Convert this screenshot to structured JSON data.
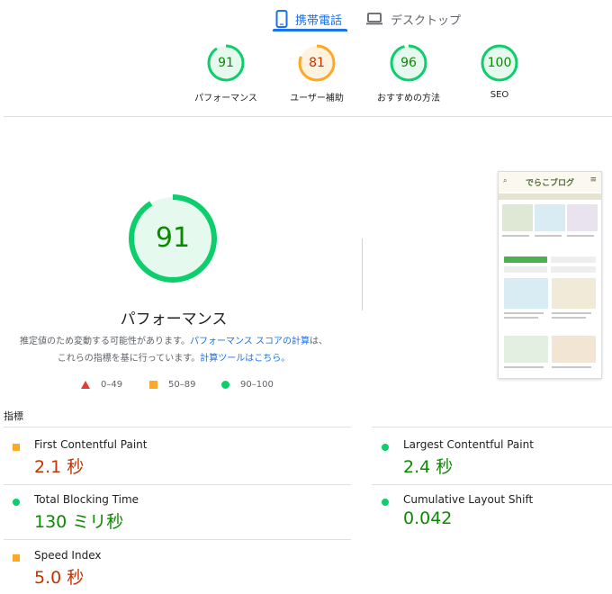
{
  "tabs": {
    "mobile_label": "携帯電話",
    "desktop_label": "デスクトップ"
  },
  "summary": [
    {
      "score": "91",
      "label": "パフォーマンス",
      "fraction": 0.91,
      "color": "#0cce6b",
      "bg": "#e6f9ee",
      "text_color": "#0b8a00"
    },
    {
      "score": "81",
      "label": "ユーザー補助",
      "fraction": 0.81,
      "color": "#ffa726",
      "bg": "#fff3e0",
      "text_color": "#c33300"
    },
    {
      "score": "96",
      "label": "おすすめの方法",
      "fraction": 0.96,
      "color": "#0cce6b",
      "bg": "#e6f9ee",
      "text_color": "#0b8a00"
    },
    {
      "score": "100",
      "label": "SEO",
      "fraction": 1.0,
      "color": "#0cce6b",
      "bg": "#e6f9ee",
      "text_color": "#0b8a00"
    }
  ],
  "main": {
    "score": "91",
    "fraction": 0.91,
    "title": "パフォーマンス",
    "note_1": "推定値のため変動する可能性があります。",
    "note_link_1": "パフォーマンス スコアの計算",
    "note_2": "は、これらの指標を基に行っています。",
    "note_link_2": "計算ツールはこちら。"
  },
  "legend": {
    "fail": "0–49",
    "average": "50–89",
    "pass": "90–100"
  },
  "thumbnail": {
    "logo_text": "でらこブログ"
  },
  "metrics_heading": "指標",
  "metrics": [
    {
      "name": "First Contentful Paint",
      "value": "2.1 秒",
      "status": "average"
    },
    {
      "name": "Largest Contentful Paint",
      "value": "2.4 秒",
      "status": "pass"
    },
    {
      "name": "Total Blocking Time",
      "value": "130 ミリ秒",
      "status": "pass"
    },
    {
      "name": "Cumulative Layout Shift",
      "value": "0.042",
      "status": "pass"
    },
    {
      "name": "Speed Index",
      "value": "5.0 秒",
      "status": "average"
    }
  ],
  "colors": {
    "accent": "#1a73e8",
    "pass": "#0cce6b",
    "average": "#ffa726",
    "fail": "#e53935"
  }
}
